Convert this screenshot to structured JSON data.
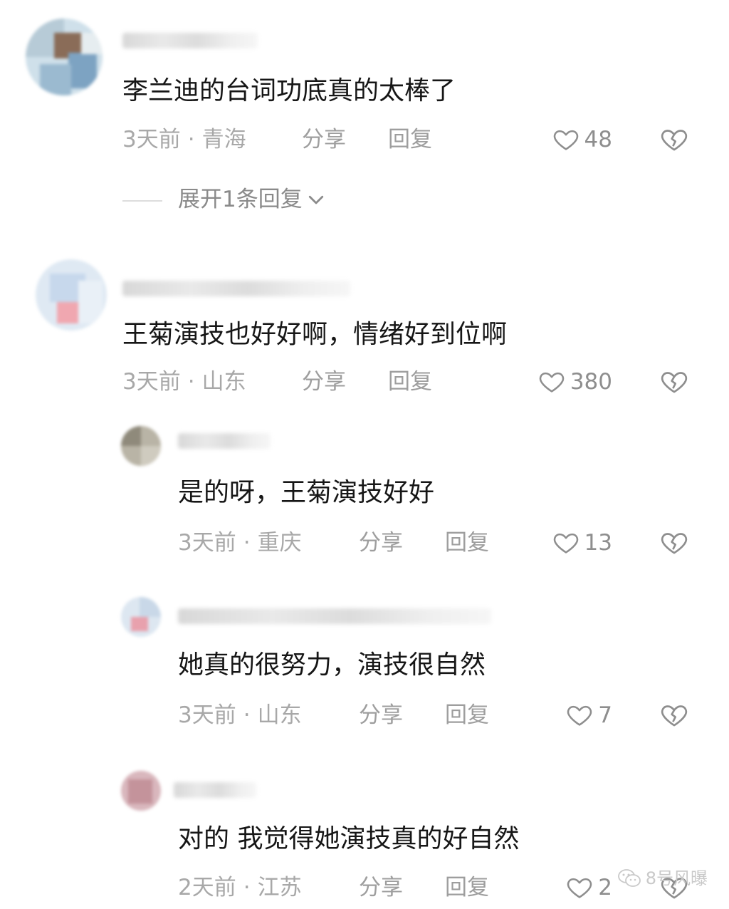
{
  "comments": [
    {
      "text": "李兰迪的台词功底真的太棒了",
      "time": "3天前",
      "location": "青海",
      "share": "分享",
      "reply": "回复",
      "likes": "48",
      "expand_replies": "展开1条回复"
    },
    {
      "text": "王菊演技也好好啊，情绪好到位啊",
      "time": "3天前",
      "location": "山东",
      "share": "分享",
      "reply": "回复",
      "likes": "380"
    },
    {
      "text": "是的呀，王菊演技好好",
      "time": "3天前",
      "location": "重庆",
      "share": "分享",
      "reply": "回复",
      "likes": "13"
    },
    {
      "text": "她真的很努力，演技很自然",
      "time": "3天前",
      "location": "山东",
      "share": "分享",
      "reply": "回复",
      "likes": "7"
    },
    {
      "text": "对的 我觉得她演技真的好自然",
      "time": "2天前",
      "location": "江苏",
      "share": "分享",
      "reply": "回复",
      "likes": "2"
    }
  ],
  "separator": "·",
  "watermark": "8号风曝",
  "icons": {
    "like": "heart-outline-icon",
    "dislike": "broken-heart-icon",
    "expand": "chevron-down-icon",
    "watermark": "wechat-icon"
  },
  "colors": {
    "text": "#161616",
    "meta": "#a8a8a8",
    "icon": "#8e8e8e"
  }
}
